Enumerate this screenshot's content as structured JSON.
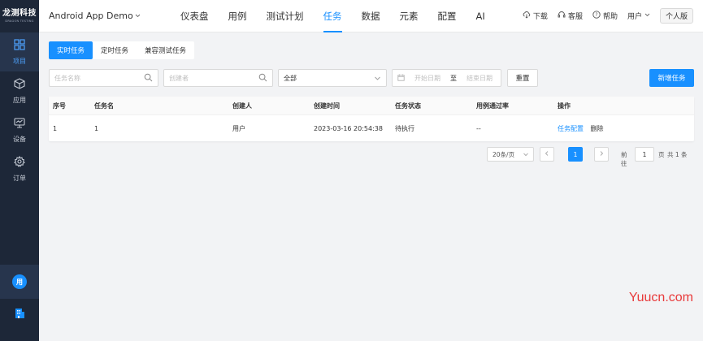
{
  "sidebar": {
    "logo_cn": "龙测科技",
    "logo_en": "DRAGON TESTING",
    "items": [
      {
        "label": "项目",
        "icon": "grid-icon",
        "active": true
      },
      {
        "label": "应用",
        "icon": "cube-icon",
        "active": false
      },
      {
        "label": "设备",
        "icon": "monitor-icon",
        "active": false
      },
      {
        "label": "订单",
        "icon": "gear-icon",
        "active": false
      }
    ],
    "avatar_text": "用"
  },
  "header": {
    "app_name": "Android App Demo",
    "nav": [
      "仪表盘",
      "用例",
      "测试计划",
      "任务",
      "数据",
      "元素",
      "配置",
      "AI"
    ],
    "active_nav": "任务",
    "download": "下载",
    "service": "客服",
    "help": "帮助",
    "user": "用户",
    "edition": "个人版"
  },
  "tabs": [
    "实时任务",
    "定时任务",
    "兼容测试任务"
  ],
  "filters": {
    "task_name_placeholder": "任务名称",
    "creator_placeholder": "创建者",
    "status_value": "全部",
    "start_date_placeholder": "开始日期",
    "date_separator": "至",
    "end_date_placeholder": "结束日期",
    "reset_label": "重置",
    "new_task_label": "新增任务"
  },
  "table": {
    "headers": [
      "序号",
      "任务名",
      "创建人",
      "创建时间",
      "任务状态",
      "用例通过率",
      "操作"
    ],
    "rows": [
      {
        "index": "1",
        "name": "1",
        "creator": "用户",
        "created_at": "2023-03-16 20:54:38",
        "status": "待执行",
        "pass_rate": "--",
        "action_config": "任务配置",
        "action_delete": "删除"
      }
    ]
  },
  "pagination": {
    "page_size": "20条/页",
    "current_page": "1",
    "goto_label": "前往",
    "goto_value": "1",
    "page_unit": "页",
    "total": "共 1 条"
  },
  "watermark": "Yuucn.com",
  "colors": {
    "accent": "#1890ff",
    "sidebar_bg": "#1d2738",
    "watermark": "#e8393a"
  }
}
